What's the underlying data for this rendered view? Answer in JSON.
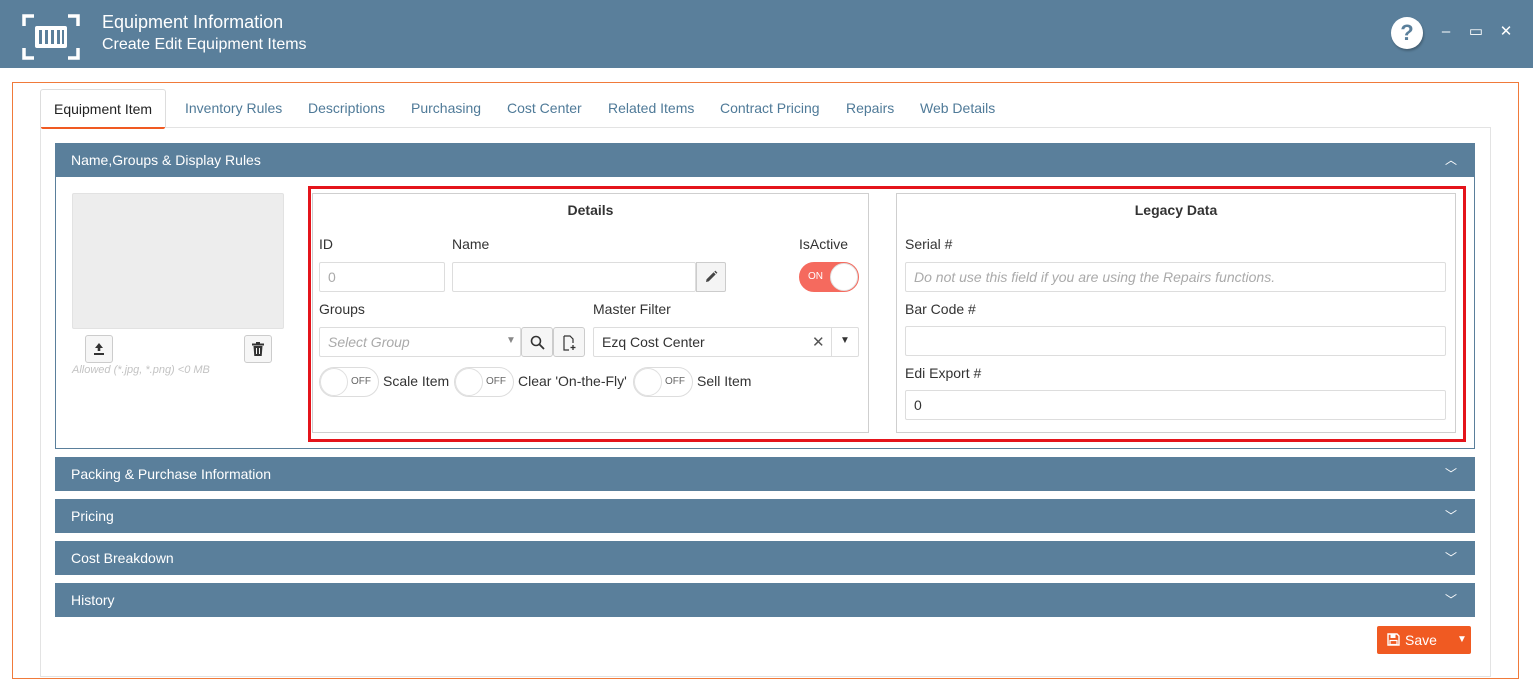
{
  "header": {
    "title": "Equipment Information",
    "subtitle": "Create Edit Equipment Items",
    "help_label": "?",
    "minimize_label": "–",
    "maximize_label": "▭",
    "close_label": "✕"
  },
  "tabs": [
    {
      "label": "Equipment Item",
      "active": true
    },
    {
      "label": "Inventory Rules"
    },
    {
      "label": "Descriptions"
    },
    {
      "label": "Purchasing"
    },
    {
      "label": "Cost Center"
    },
    {
      "label": "Related Items"
    },
    {
      "label": "Contract Pricing"
    },
    {
      "label": "Repairs"
    },
    {
      "label": "Web Details"
    }
  ],
  "sections": {
    "name_groups": "Name,Groups & Display Rules",
    "packing": "Packing & Purchase Information",
    "pricing": "Pricing",
    "cost_breakdown": "Cost Breakdown",
    "history": "History"
  },
  "image": {
    "hint": "Allowed (*.jpg, *.png) <0 MB"
  },
  "details": {
    "title": "Details",
    "id_label": "ID",
    "id_value": "0",
    "name_label": "Name",
    "name_value": "",
    "isactive_label": "IsActive",
    "isactive_state": "ON",
    "groups_label": "Groups",
    "groups_placeholder": "Select Group",
    "master_filter_label": "Master Filter",
    "master_filter_value": "Ezq Cost Center",
    "scale_item_label": "Scale Item",
    "scale_item_state": "OFF",
    "clear_otf_label": "Clear 'On-the-Fly'",
    "clear_otf_state": "OFF",
    "sell_item_label": "Sell Item",
    "sell_item_state": "OFF"
  },
  "legacy": {
    "title": "Legacy Data",
    "serial_label": "Serial #",
    "serial_placeholder": "Do not use this field if you are using the Repairs functions.",
    "barcode_label": "Bar Code #",
    "barcode_value": "",
    "edi_label": "Edi Export #",
    "edi_value": "0"
  },
  "footer": {
    "save_label": "Save"
  },
  "colors": {
    "header_bg": "#5a7f9b",
    "accent": "#f05a22",
    "highlight_frame": "#e4141b",
    "toggle_on": "#f56a5e"
  }
}
